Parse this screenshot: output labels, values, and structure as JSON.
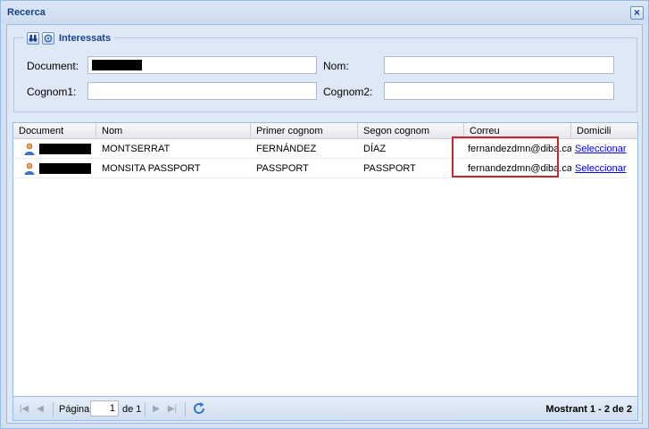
{
  "window": {
    "title": "Recerca",
    "close_symbol": "×"
  },
  "filters": {
    "legend": "Interessats",
    "legend_icons": [
      "binoculars-icon",
      "settings-icon"
    ],
    "document_label": "Document:",
    "document_value": "",
    "nom_label": "Nom:",
    "nom_value": "",
    "cognom1_label": "Cognom1:",
    "cognom1_value": "",
    "cognom2_label": "Cognom2:",
    "cognom2_value": ""
  },
  "grid": {
    "columns": [
      "Document",
      "Nom",
      "Primer cognom",
      "Segon cognom",
      "Correu",
      "Domicili"
    ],
    "rows": [
      {
        "document": "",
        "nom": "MONTSERRAT",
        "primer_cognom": "FERNÁNDEZ",
        "segon_cognom": "DÍAZ",
        "correu": "fernandezdmn@diba.cat",
        "domicili": "Seleccionar"
      },
      {
        "document": "",
        "nom": "MONSITA PASSPORT",
        "primer_cognom": "PASSPORT",
        "segon_cognom": "PASSPORT",
        "correu": "fernandezdmn@diba.cat",
        "domicili": "Seleccionar"
      }
    ],
    "highlight_color": "#c0292f"
  },
  "pager": {
    "page_label": "Página",
    "page_value": "1",
    "of_label": "de 1",
    "status": "Mostrant 1 - 2 de 2"
  }
}
